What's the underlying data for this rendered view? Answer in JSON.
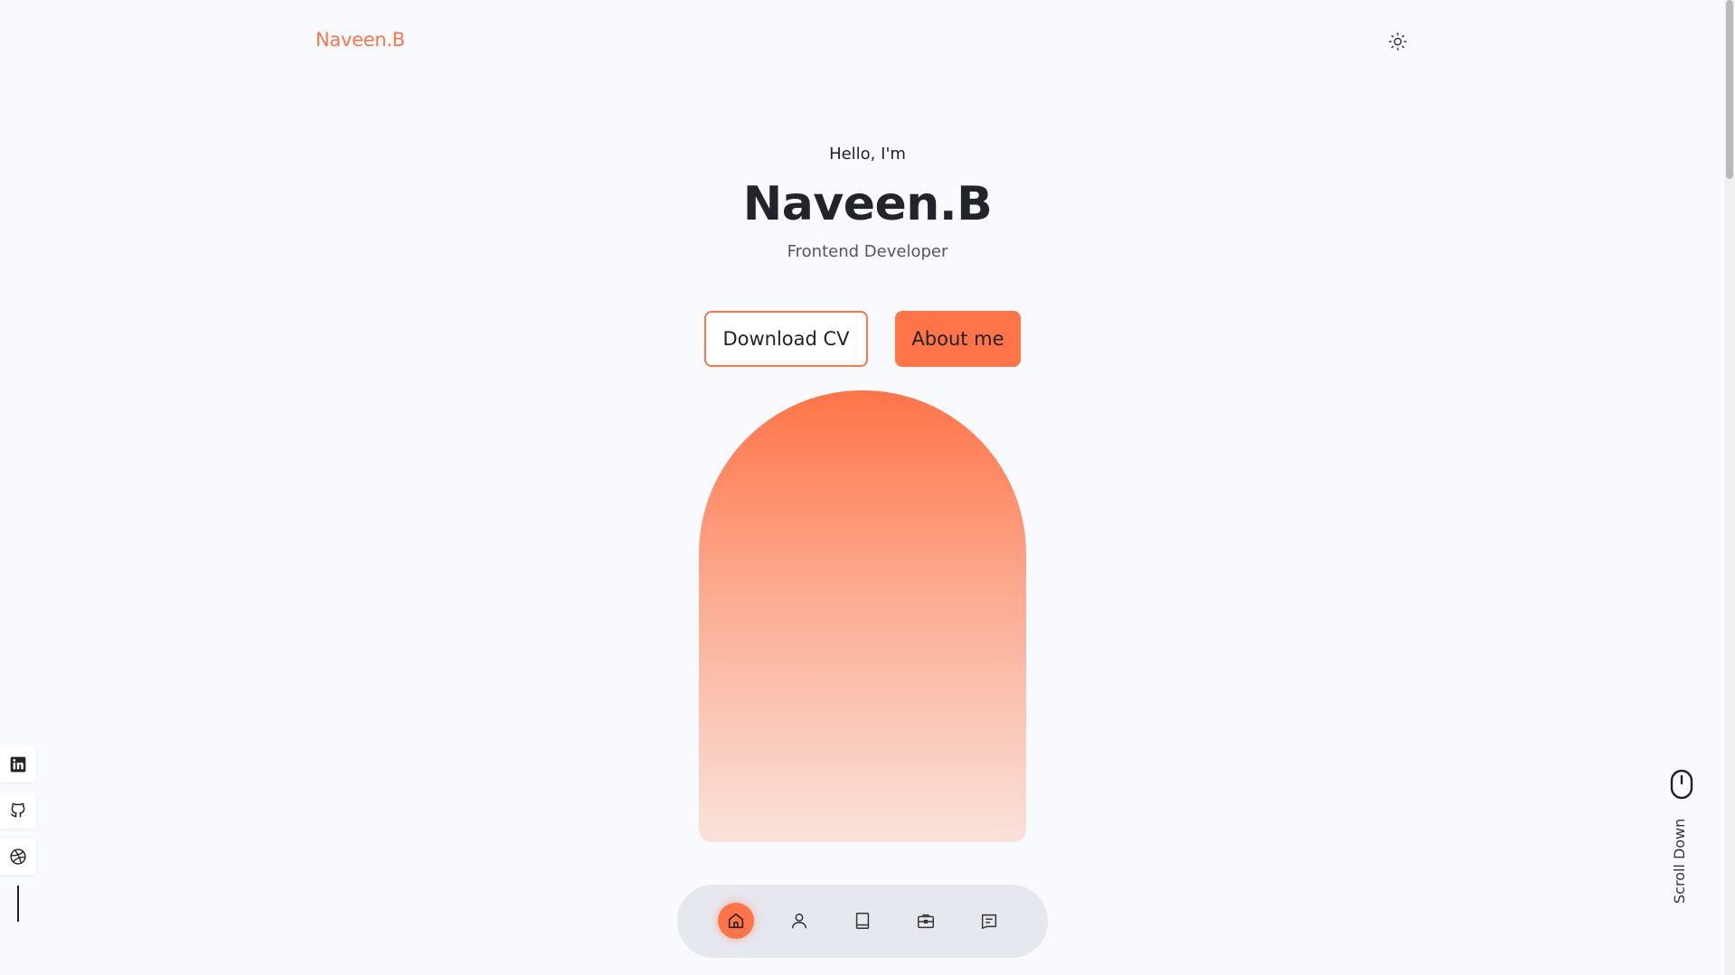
{
  "header": {
    "logo": "Naveen.B",
    "theme_toggle_icon": "sun-icon"
  },
  "hero": {
    "greeting": "Hello, I'm",
    "name": "Naveen.B",
    "role": "Frontend Developer",
    "download_cv_label": "Download CV",
    "about_me_label": "About me"
  },
  "bottom_nav": {
    "items": [
      {
        "icon": "home-icon",
        "active": true
      },
      {
        "icon": "user-icon",
        "active": false
      },
      {
        "icon": "book-icon",
        "active": false
      },
      {
        "icon": "briefcase-icon",
        "active": false
      },
      {
        "icon": "message-icon",
        "active": false
      }
    ]
  },
  "socials": [
    "linkedin-icon",
    "github-icon",
    "dribbble-icon"
  ],
  "scroll": {
    "label": "Scroll Down",
    "icon": "mouse-icon"
  },
  "colors": {
    "accent": "#ff7448",
    "background": "#f9fafd",
    "nav_bg": "#e6e8ef"
  }
}
